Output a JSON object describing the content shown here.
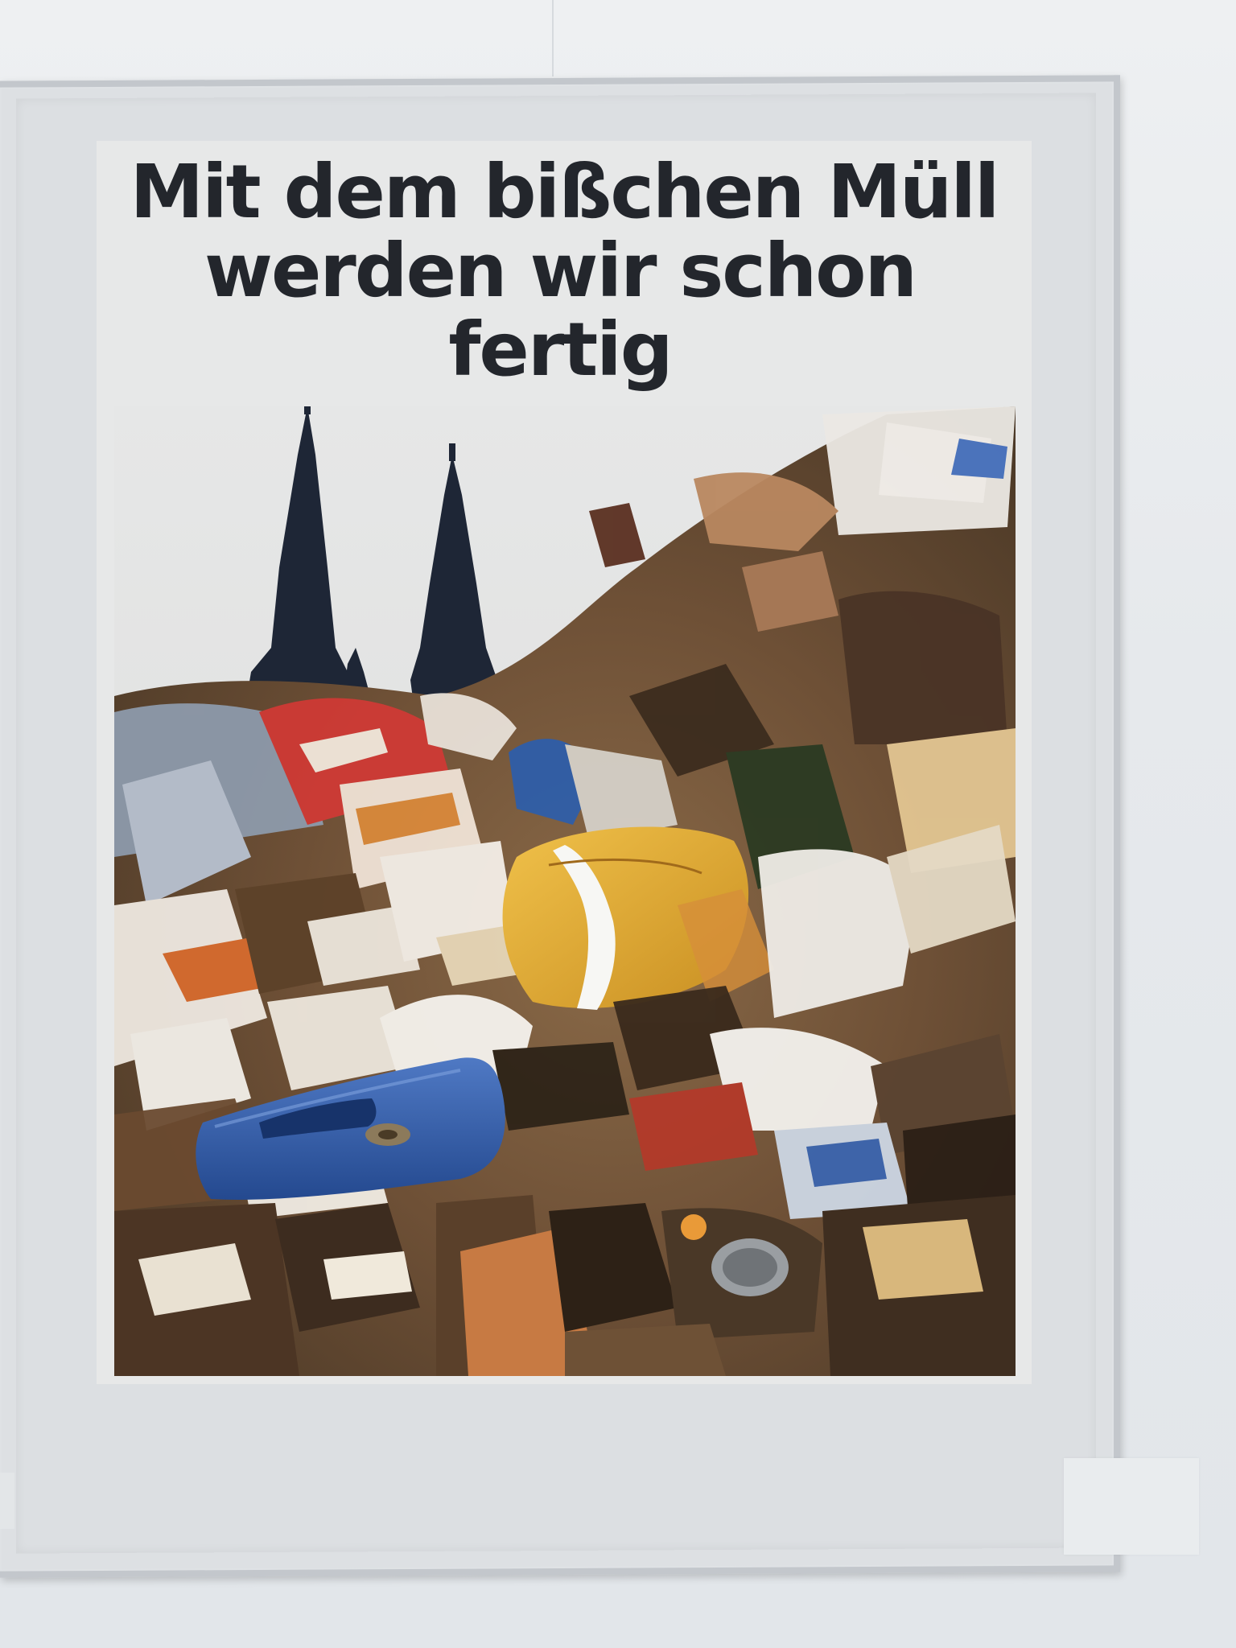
{
  "poster": {
    "headline_line1": "Mit dem bißchen Müll",
    "headline_line2": "werden wir schon fertig",
    "photo_subject": "cathedral-spires-and-garbage-heap"
  },
  "colors": {
    "headline": "#23262c",
    "frame": "#c3c7cc",
    "wall": "#e6e9ec"
  }
}
